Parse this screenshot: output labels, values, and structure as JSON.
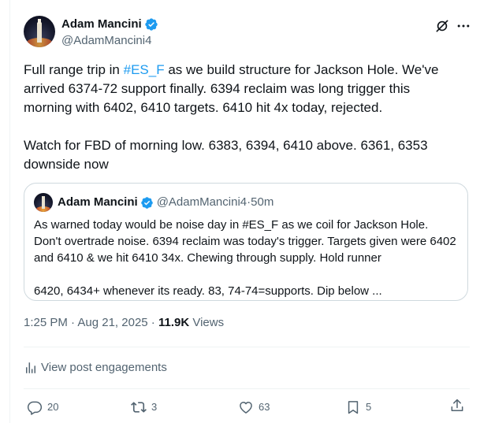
{
  "author": {
    "display_name": "Adam Mancini",
    "handle": "@AdamMancini4"
  },
  "tweet": {
    "text_before": "Full range trip in ",
    "hashtag": "#ES_F",
    "text_after": " as we build structure for Jackson Hole. We've arrived 6374-72 support finally. 6394 reclaim was long trigger this morning with 6402, 6410 targets. 6410 hit 4x today, rejected.\n\nWatch for FBD of morning low. 6383, 6394, 6410 above. 6361, 6353 downside now"
  },
  "quote": {
    "display_name": "Adam Mancini",
    "handle": "@AdamMancini4",
    "separator": " · ",
    "age": "50m",
    "text": "As warned today would be noise day in #ES_F as we coil for Jackson Hole. Don't overtrade noise. 6394 reclaim was today's trigger. Targets given were 6402 and 6410 & we hit 6410 34x. Chewing through supply. Hold runner\n\n6420, 6434+ whenever its ready. 83, 74-74=supports. Dip below ..."
  },
  "meta": {
    "time": "1:25 PM",
    "dot1": " · ",
    "date": "Aug 21, 2025",
    "dot2": " · ",
    "views_count": "11.9K",
    "views_label": " Views"
  },
  "engagements_link": "View post engagements",
  "actions": {
    "replies": "20",
    "reposts": "3",
    "likes": "63",
    "bookmarks": "5"
  },
  "colors": {
    "link": "#1d9bf0",
    "secondary_text": "#536471",
    "border": "#cfd9de"
  }
}
